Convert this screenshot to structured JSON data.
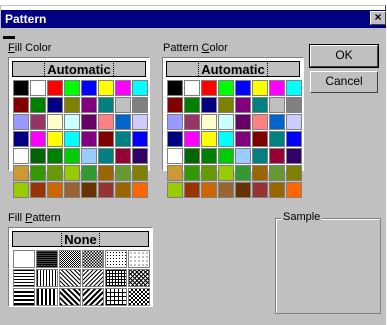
{
  "dialog": {
    "title": "Pattern",
    "close_glyph": "×"
  },
  "fill_color": {
    "label_accel": "F",
    "label_rest": "ill Color",
    "automatic_label": "Automatic",
    "colors": [
      [
        "#000000",
        "#ffffff",
        "#ff0000",
        "#00ff00",
        "#0000ff",
        "#ffff00",
        "#ff00ff",
        "#00ffff"
      ],
      [
        "#800000",
        "#008000",
        "#000080",
        "#808000",
        "#800080",
        "#008080",
        "#c0c0c0",
        "#808080"
      ],
      [
        "#9999ff",
        "#993366",
        "#ffffcc",
        "#ccffff",
        "#660066",
        "#ff8080",
        "#0066cc",
        "#ccccff"
      ],
      [
        "#000080",
        "#ff00ff",
        "#ffff00",
        "#00ffff",
        "#800080",
        "#800000",
        "#008080",
        "#0000ff"
      ],
      [
        "#ffffff",
        "#006600",
        "#008000",
        "#00cc00",
        "#99ccff",
        "#008080",
        "#990033",
        "#330066"
      ],
      [
        "#cc9933",
        "#339900",
        "#669900",
        "#99cc00",
        "#339933",
        "#996600",
        "#669933",
        "#808000"
      ],
      [
        "#99cc00",
        "#993300",
        "#cc6600",
        "#996633",
        "#663300",
        "#993333",
        "#996600",
        "#ff6600"
      ]
    ]
  },
  "pattern_color": {
    "label_pre": "Pattern ",
    "label_accel": "C",
    "label_rest": "olor",
    "automatic_label": "Automatic",
    "colors": [
      [
        "#000000",
        "#ffffff",
        "#ff0000",
        "#00ff00",
        "#0000ff",
        "#ffff00",
        "#ff00ff",
        "#00ffff"
      ],
      [
        "#800000",
        "#008000",
        "#000080",
        "#808000",
        "#800080",
        "#008080",
        "#c0c0c0",
        "#808080"
      ],
      [
        "#9999ff",
        "#993366",
        "#ffffcc",
        "#ccffff",
        "#660066",
        "#ff8080",
        "#0066cc",
        "#ccccff"
      ],
      [
        "#000080",
        "#ff00ff",
        "#ffff00",
        "#00ffff",
        "#800080",
        "#800000",
        "#008080",
        "#0000ff"
      ],
      [
        "#ffffff",
        "#006600",
        "#008000",
        "#00cc00",
        "#99ccff",
        "#008080",
        "#990033",
        "#330066"
      ],
      [
        "#cc9933",
        "#339900",
        "#669900",
        "#99cc00",
        "#339933",
        "#996600",
        "#669933",
        "#808000"
      ],
      [
        "#99cc00",
        "#993300",
        "#cc6600",
        "#996633",
        "#663300",
        "#993333",
        "#996600",
        "#ff6600"
      ]
    ]
  },
  "fill_pattern": {
    "label_pre": "Fill ",
    "label_accel": "P",
    "label_rest": "attern",
    "none_label": "None",
    "patterns": [
      [
        "solid-white",
        "dense-dark",
        "medium-gray",
        "light-dots",
        "fine-dots",
        "sparse-dots"
      ],
      [
        "horizontal-lines",
        "vertical-lines",
        "diagonal-down",
        "diagonal-up",
        "crosshatch",
        "diagonal-crosshatch"
      ],
      [
        "thick-horizontal",
        "thick-vertical",
        "thick-diagonal-down",
        "thick-diagonal-up",
        "grid",
        "checker"
      ]
    ]
  },
  "buttons": {
    "ok": "OK",
    "cancel": "Cancel"
  },
  "sample": {
    "title": "Sample"
  }
}
